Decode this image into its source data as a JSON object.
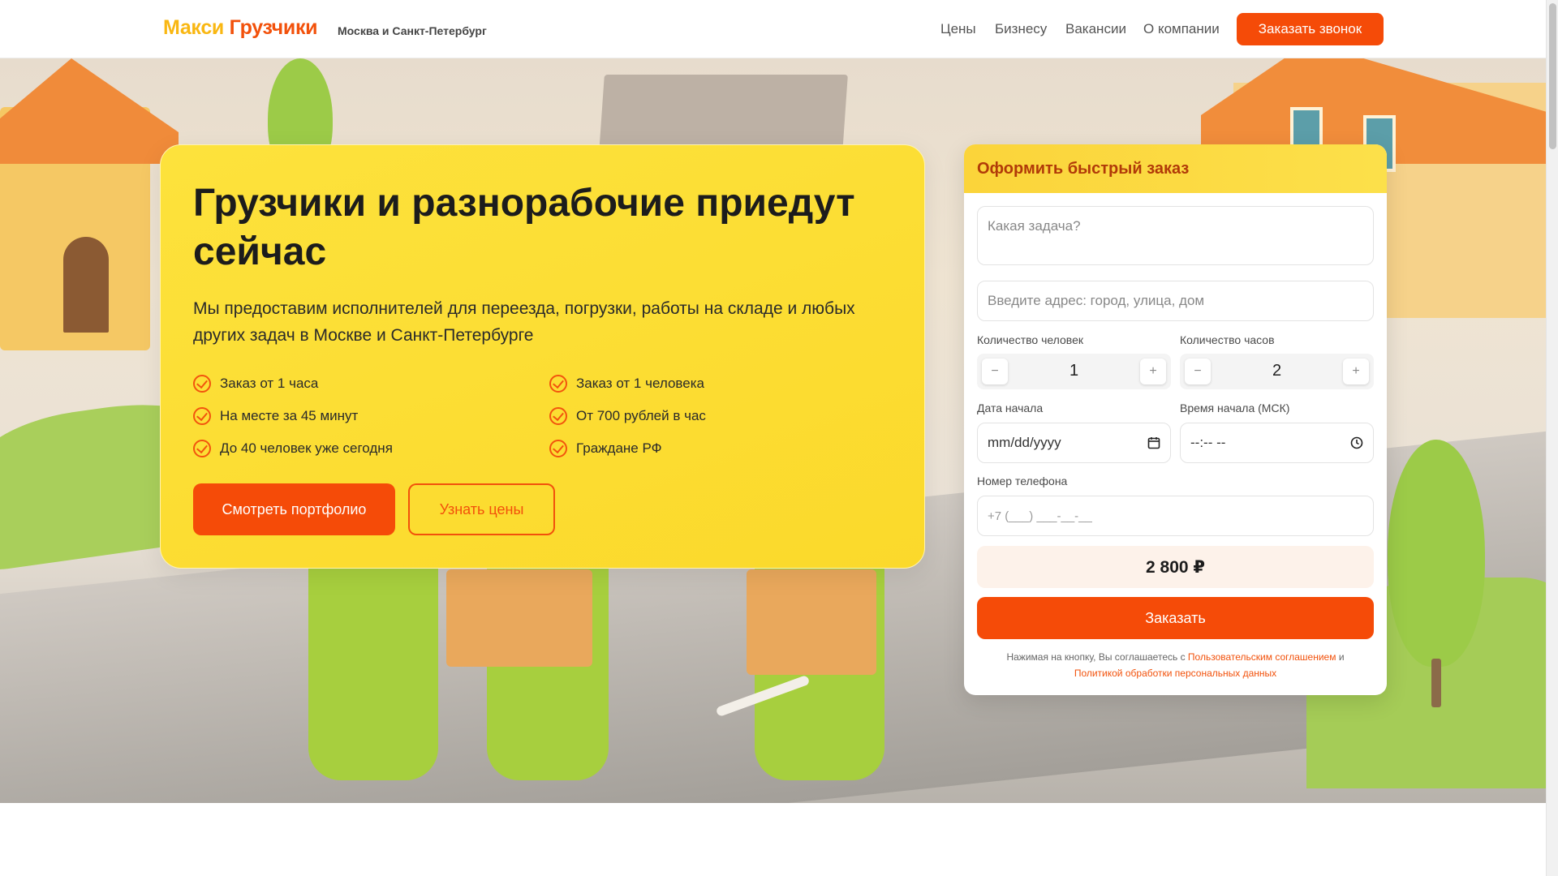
{
  "header": {
    "logo_part1": "Макси",
    "logo_part2": "Грузчики",
    "city": "Москва и Санкт-Петербург",
    "nav": [
      "Цены",
      "Бизнесу",
      "Вакансии",
      "О компании"
    ],
    "call_button": "Заказать звонок"
  },
  "hero": {
    "title": "Грузчики и разнорабочие приедут сейчас",
    "subtitle": "Мы предоставим исполнителей для переезда, погрузки, работы на складе и любых других задач в Москве и Санкт-Петербурге",
    "features": [
      "Заказ от 1 часа",
      "Заказ от 1 человека",
      "На месте за 45 минут",
      "От 700 рублей в час",
      "До 40 человек уже сегодня",
      "Граждане РФ"
    ],
    "btn_portfolio": "Смотреть портфолио",
    "btn_prices": "Узнать цены"
  },
  "form": {
    "title": "Оформить быстрый заказ",
    "task_placeholder": "Какая задача?",
    "address_placeholder": "Введите адрес: город, улица, дом",
    "people_label": "Количество человек",
    "people_value": "1",
    "hours_label": "Количество часов",
    "hours_value": "2",
    "minus": "−",
    "plus": "+",
    "date_label": "Дата начала",
    "date_value": "mm/dd/yyyy",
    "time_label": "Время начала (МСК)",
    "time_value": "--:-- --",
    "phone_label": "Номер телефона",
    "phone_placeholder": "+7 (___) ___-__-__",
    "price": "2 800 ₽",
    "submit": "Заказать",
    "consent_text": "Нажимая на кнопку, Вы соглашаетесь с",
    "consent_link1": "Пользовательским соглашением",
    "consent_and": "и",
    "consent_link2": "Политикой обработки персональных данных"
  },
  "colors": {
    "accent": "#f54b08",
    "brand_yellow": "#f9b712",
    "card_yellow": "#fbd92b"
  },
  "icons": [
    "check-circle-icon",
    "calendar-icon",
    "clock-icon"
  ]
}
